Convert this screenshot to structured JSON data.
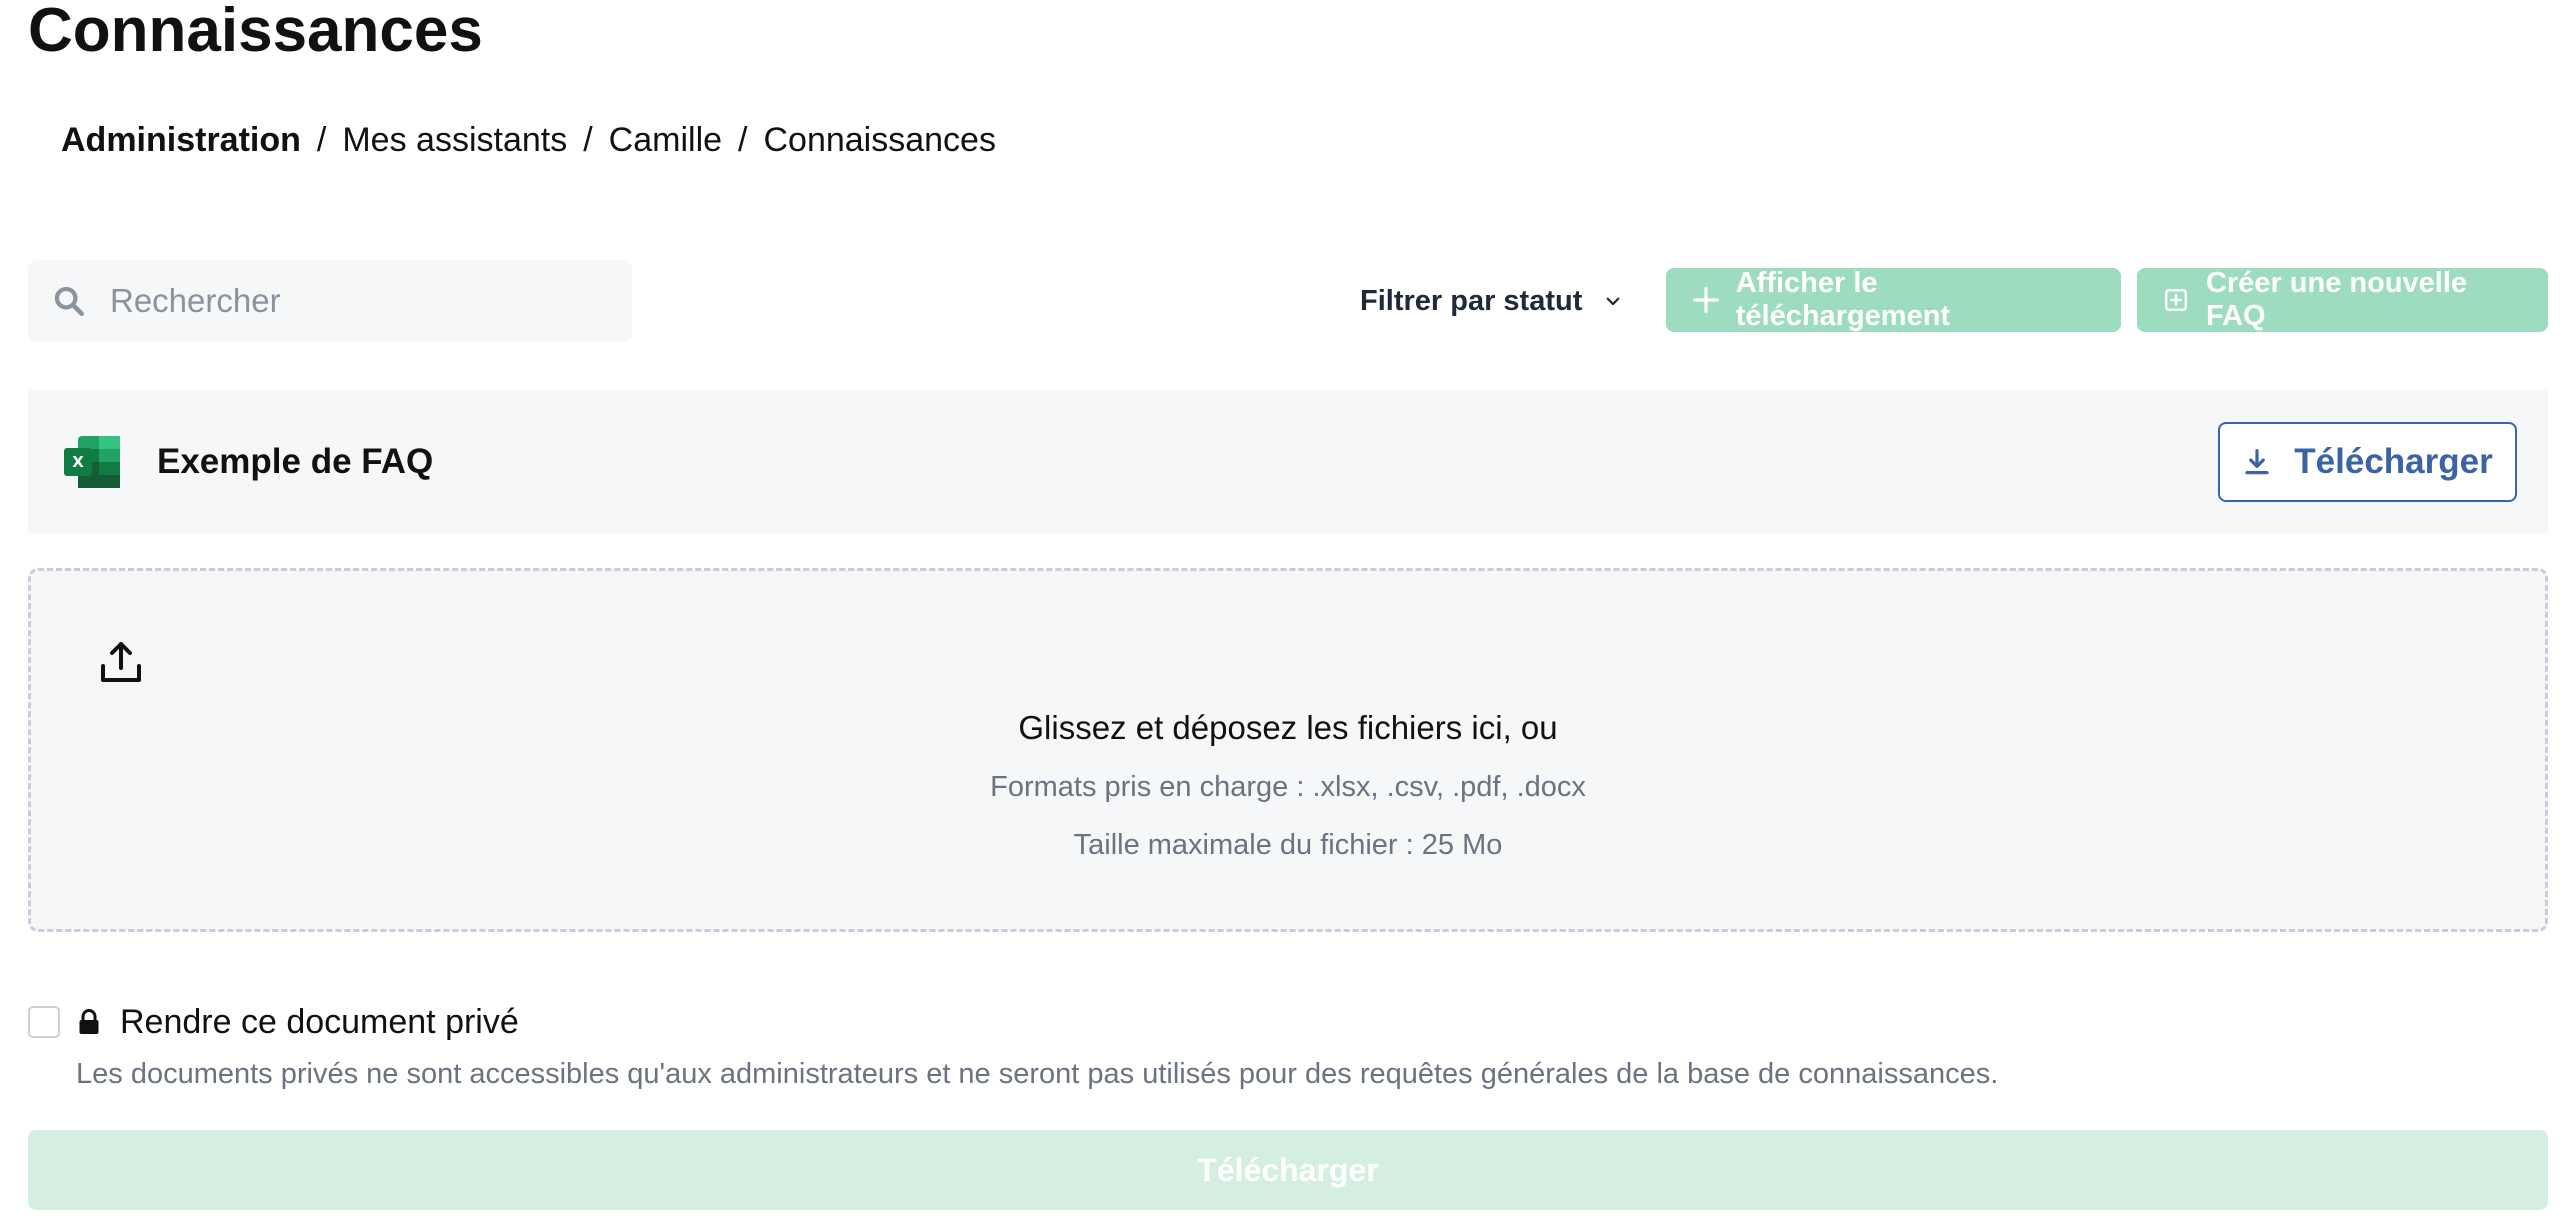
{
  "page": {
    "title": "Connaissances"
  },
  "breadcrumb": {
    "items": [
      "Administration",
      "Mes assistants",
      "Camille",
      "Connaissances"
    ],
    "separator": "/"
  },
  "toolbar": {
    "search_placeholder": "Rechercher",
    "filter_label": "Filtrer par statut",
    "show_upload_label": "Afficher le téléchargement",
    "new_faq_label": "Créer une nouvelle FAQ"
  },
  "faq_example": {
    "title": "Exemple de FAQ",
    "download_label": "Télécharger",
    "icon": "excel-icon"
  },
  "dropzone": {
    "main_text": "Glissez et déposez les fichiers ici, ou",
    "formats_text": "Formats pris en charge : .xlsx, .csv, .pdf, .docx",
    "max_size_text": "Taille maximale du fichier : 25 Mo",
    "icon": "upload-icon"
  },
  "private_option": {
    "checked": false,
    "label": "Rendre ce document privé",
    "help": "Les documents privés ne sont accessibles qu'aux administrateurs et ne seront pas utilisés pour des requêtes générales de la base de connaissances."
  },
  "submit": {
    "label": "Télécharger"
  },
  "colors": {
    "accent_green": "#9ddcbe",
    "accent_green_light": "#d4efe2",
    "link_blue": "#3b63a8",
    "muted_text": "#6b7280",
    "panel_bg": "#f6f7f9"
  }
}
